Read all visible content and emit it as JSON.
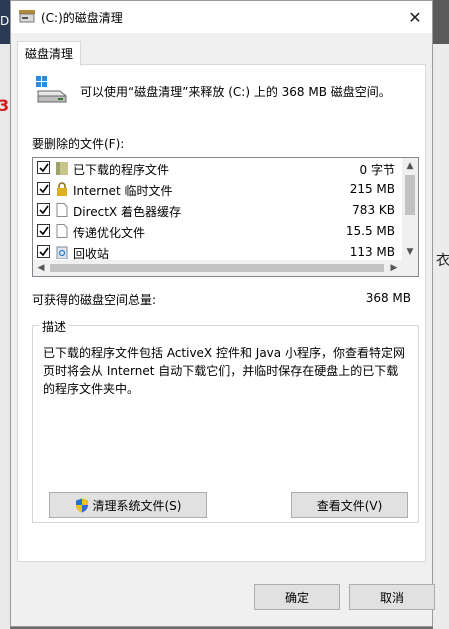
{
  "window": {
    "title": "(C:)的磁盘清理",
    "close_glyph": "✕"
  },
  "tab": {
    "label": "磁盘清理"
  },
  "intro": {
    "text": "可以使用“磁盘清理”来释放 (C:) 上的 368 MB 磁盘空间。"
  },
  "files": {
    "label": "要删除的文件(F):",
    "items": [
      {
        "name": "已下载的程序文件",
        "size": "0 字节",
        "checked": true,
        "icon": "folder-icon"
      },
      {
        "name": "Internet 临时文件",
        "size": "215 MB",
        "checked": true,
        "icon": "lock-icon"
      },
      {
        "name": "DirectX 着色器缓存",
        "size": "783 KB",
        "checked": true,
        "icon": "file-icon"
      },
      {
        "name": "传递优化文件",
        "size": "15.5 MB",
        "checked": true,
        "icon": "file-icon"
      },
      {
        "name": "回收站",
        "size": "113 MB",
        "checked": true,
        "icon": "recycle-bin-icon"
      }
    ]
  },
  "total": {
    "label": "可获得的磁盘空间总量:",
    "value": "368 MB"
  },
  "description": {
    "legend": "描述",
    "text": "已下载的程序文件包括 ActiveX 控件和 Java 小程序，你查看特定网页时将会从 Internet 自动下载它们，并临时保存在硬盘上的已下载的程序文件夹中。"
  },
  "buttons": {
    "cleanup_system": "清理系统文件(S)",
    "view_files": "查看文件(V)",
    "ok": "确定",
    "cancel": "取消"
  },
  "background": {
    "left_text": "D",
    "left_red_text": "3",
    "right_text": "衣"
  },
  "colors": {
    "selection_border": "#0078d7",
    "button_bg": "#e1e1e1",
    "dialog_bg": "#f0f0f0"
  }
}
